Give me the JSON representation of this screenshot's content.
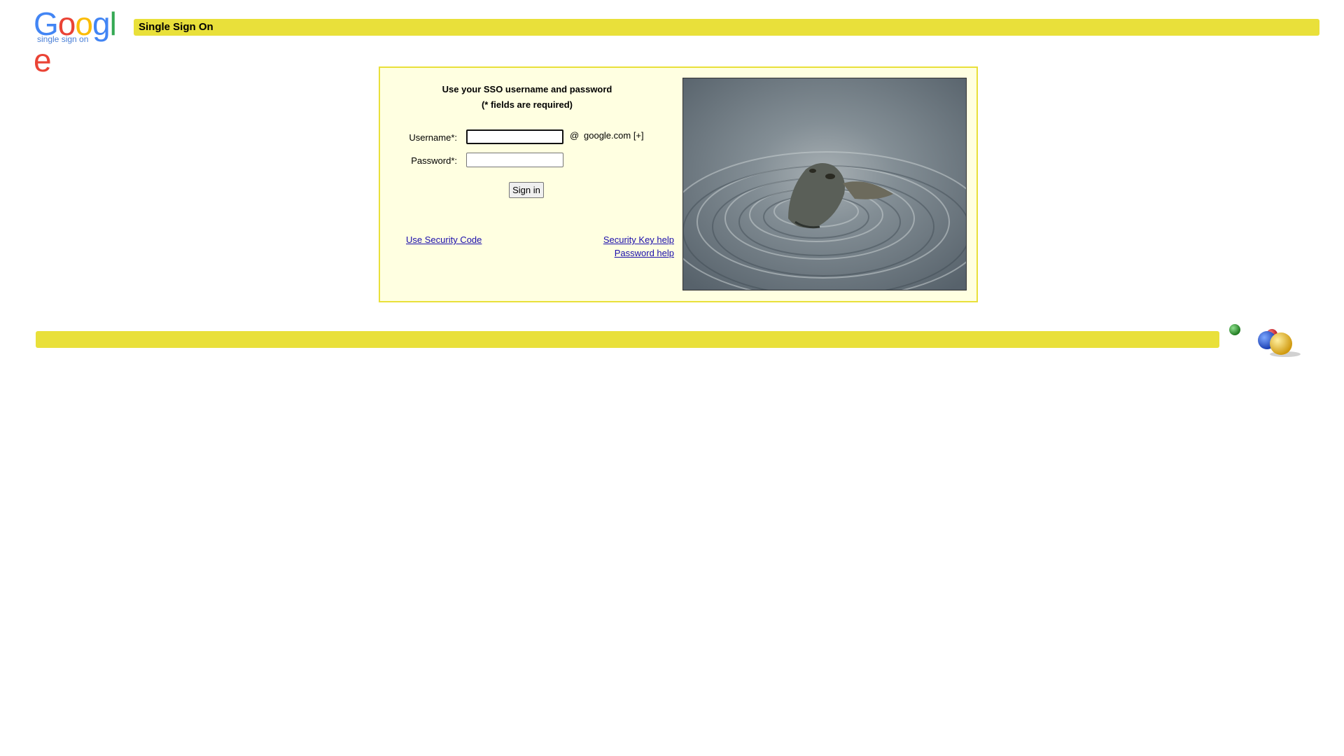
{
  "header": {
    "logo_letters": [
      "G",
      "o",
      "o",
      "g",
      "l",
      "e"
    ],
    "logo_colors": [
      "#4285f4",
      "#ea4335",
      "#fbbc05",
      "#4285f4",
      "#34a853",
      "#ea4335"
    ],
    "logo_subtitle": "single sign on",
    "title": "Single Sign On"
  },
  "form": {
    "heading_line1": "Use your SSO username and password",
    "heading_line2": "(* fields are required)",
    "username_label": "Username*:",
    "username_value": "",
    "password_label": "Password*:",
    "password_value": "",
    "at_sign": "@",
    "domain": "google.com [+]",
    "signin_label": "Sign in"
  },
  "links": {
    "security_code": "Use Security Code",
    "security_key_help": "Security Key help",
    "password_help": "Password help"
  },
  "colors": {
    "accent_yellow": "#e9e03a",
    "panel_background": "#ffffe1",
    "link": "#1a0dab"
  }
}
